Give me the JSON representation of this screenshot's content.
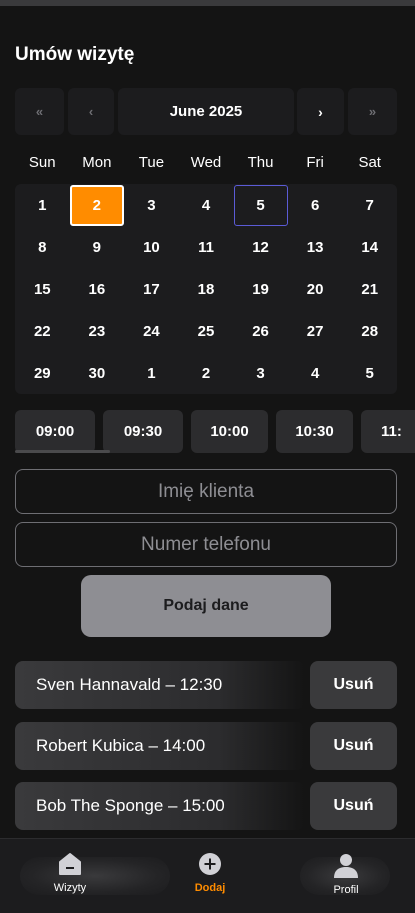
{
  "header": {
    "title": "Umów wizytę"
  },
  "calendar": {
    "nav": {
      "first": "«",
      "prev": "‹",
      "next": "›",
      "last": "»"
    },
    "month_label": "June 2025",
    "weekdays": [
      "Sun",
      "Mon",
      "Tue",
      "Wed",
      "Thu",
      "Fri",
      "Sat"
    ],
    "days": [
      "1",
      "2",
      "3",
      "4",
      "5",
      "6",
      "7",
      "8",
      "9",
      "10",
      "11",
      "12",
      "13",
      "14",
      "15",
      "16",
      "17",
      "18",
      "19",
      "20",
      "21",
      "22",
      "23",
      "24",
      "25",
      "26",
      "27",
      "28",
      "29",
      "30",
      "1",
      "2",
      "3",
      "4",
      "5"
    ],
    "selected_day": "2",
    "today_day": "5"
  },
  "time_slots": [
    "09:00",
    "09:30",
    "10:00",
    "10:30",
    "11:"
  ],
  "form": {
    "name_placeholder": "Imię klienta",
    "phone_placeholder": "Numer telefonu",
    "submit_label": "Podaj dane"
  },
  "appointments": [
    {
      "label": "Sven Hannavald – 12:30",
      "delete_label": "Usuń"
    },
    {
      "label": "Robert Kubica – 14:00",
      "delete_label": "Usuń"
    },
    {
      "label": "Bob The Sponge – 15:00",
      "delete_label": "Usuń"
    }
  ],
  "tabbar": {
    "items": [
      {
        "label": "Wizyty",
        "icon": "home-icon"
      },
      {
        "label": "Dodaj",
        "icon": "add-icon"
      },
      {
        "label": "Profil",
        "icon": "user-icon"
      }
    ],
    "active_index": 1
  },
  "colors": {
    "accent": "#ff8c00",
    "today_outline": "#5b5bd6",
    "background": "#141414",
    "surface": "#1c1c1e"
  }
}
